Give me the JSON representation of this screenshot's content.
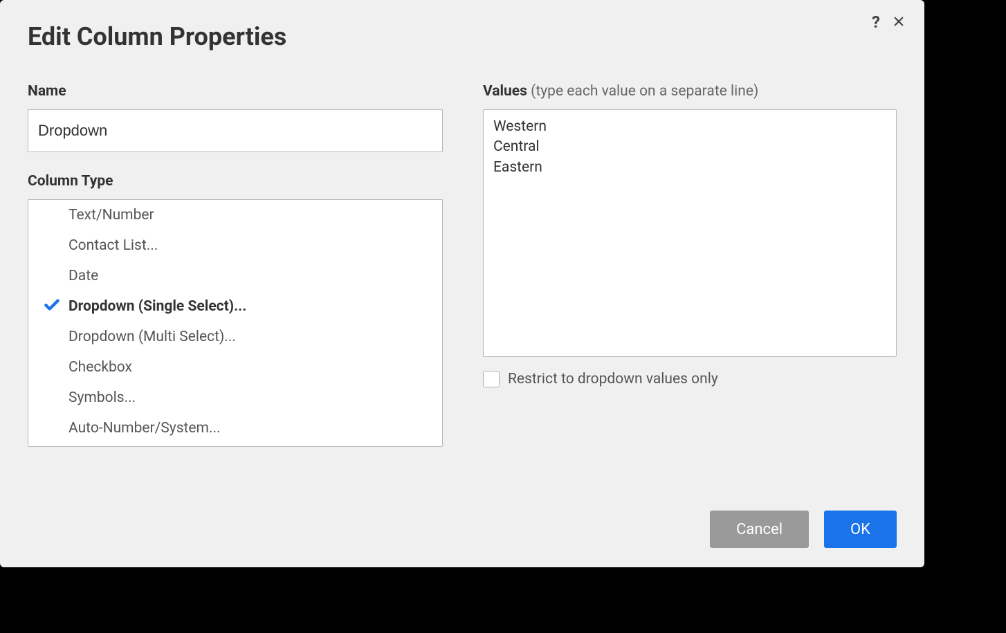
{
  "dialog": {
    "title": "Edit Column Properties",
    "help_icon": "?",
    "close_icon": "close"
  },
  "name": {
    "label": "Name",
    "value": "Dropdown"
  },
  "column_type": {
    "label": "Column Type",
    "selected_index": 3,
    "options": [
      "Text/Number",
      "Contact List...",
      "Date",
      "Dropdown (Single Select)...",
      "Dropdown (Multi Select)...",
      "Checkbox",
      "Symbols...",
      "Auto-Number/System..."
    ]
  },
  "values": {
    "label": "Values",
    "hint": "(type each value on a separate line)",
    "text": "Western\nCentral\nEastern"
  },
  "restrict": {
    "label": "Restrict to dropdown values only",
    "checked": false
  },
  "footer": {
    "cancel": "Cancel",
    "ok": "OK"
  }
}
